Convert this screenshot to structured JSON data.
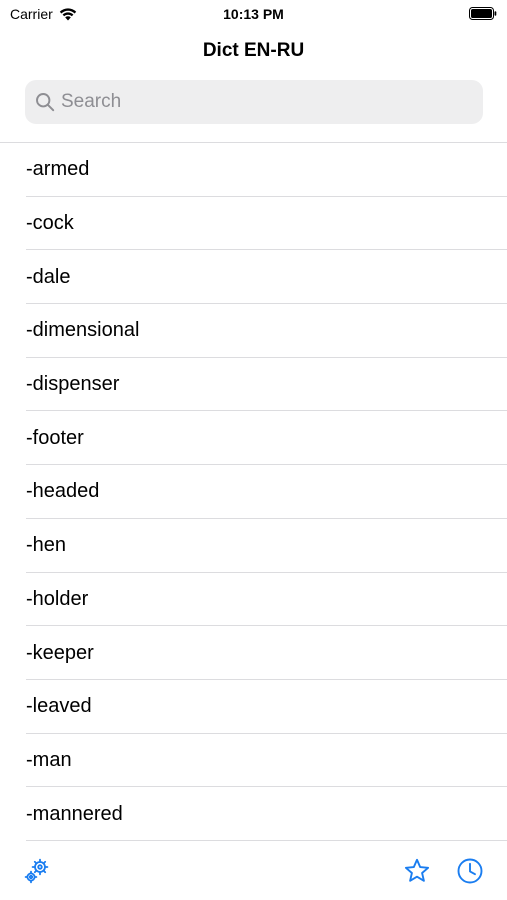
{
  "status_bar": {
    "carrier": "Carrier",
    "time": "10:13 PM"
  },
  "nav": {
    "title": "Dict EN-RU"
  },
  "search": {
    "placeholder": "Search",
    "value": ""
  },
  "words": [
    "-armed",
    "-cock",
    "-dale",
    "-dimensional",
    "-dispenser",
    "-footer",
    "-headed",
    "-hen",
    "-holder",
    "-keeper",
    "-leaved",
    "-man",
    "-mannered"
  ],
  "toolbar": {
    "icons": [
      "gears-icon",
      "star-icon",
      "clock-icon"
    ]
  },
  "colors": {
    "accent": "#1a7df0",
    "separator": "#dcdcdf",
    "search_bg": "#eeeeef",
    "placeholder": "#8e8e93"
  }
}
